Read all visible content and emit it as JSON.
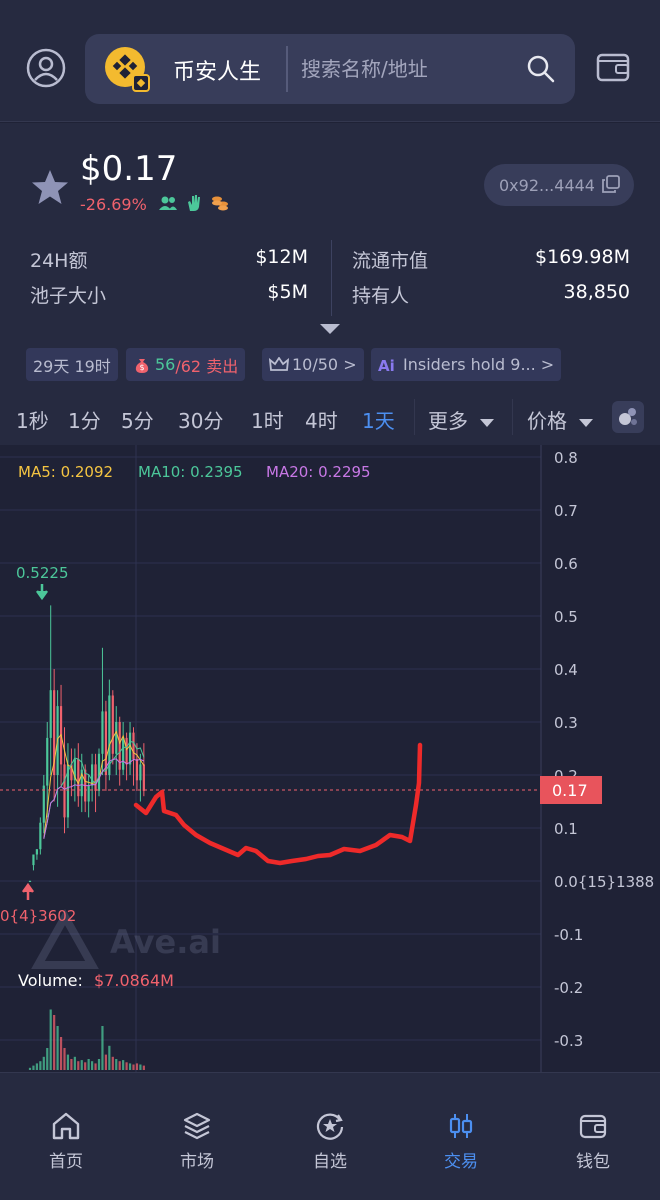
{
  "header": {
    "token_name": "币安人生",
    "search_placeholder": "搜索名称/地址"
  },
  "token": {
    "price": "$0.17",
    "change": "-26.69%",
    "address": "0x92...4444"
  },
  "stats": {
    "volume_label": "24H额",
    "volume": "$12M",
    "pool_label": "池子大小",
    "pool": "$5M",
    "mcap_label": "流通市值",
    "mcap": "$169.98M",
    "holders_label": "持有人",
    "holders": "38,850"
  },
  "tags": {
    "age": "29天 19时",
    "buys": "56",
    "sells_text": "/62 卖出",
    "top": "10/50 >",
    "insiders": "Insiders hold 9... >"
  },
  "timeframes": [
    "1秒",
    "1分",
    "5分",
    "30分",
    "1时",
    "4时",
    "1天"
  ],
  "active_timeframe": "1天",
  "more_label": "更多",
  "price_label": "价格",
  "chart_data": {
    "type": "candlestick",
    "indicators": [
      {
        "name": "MA5",
        "text": "MA5: 0.2092",
        "color": "#f5c542"
      },
      {
        "name": "MA10",
        "text": "MA10: 0.2395",
        "color": "#4cc79a"
      },
      {
        "name": "MA20",
        "text": "MA20: 0.2295",
        "color": "#c878e6"
      }
    ],
    "y_ticks": [
      "0.8",
      "0.7",
      "0.6",
      "0.5",
      "0.4",
      "0.3",
      "0.2",
      "0.1",
      "0.0{15}1388",
      "-0.1",
      "-0.2",
      "-0.3"
    ],
    "current_price": "0.17",
    "high_label": "0.5225",
    "low_label": "0{4}3602",
    "volume_label": "Volume:",
    "volume_value": "$7.0864M",
    "watermark": "Ave.ai",
    "ylim": [
      -0.35,
      0.82
    ]
  },
  "nav": [
    {
      "label": "首页",
      "icon": "home-icon"
    },
    {
      "label": "市场",
      "icon": "layers-icon"
    },
    {
      "label": "自选",
      "icon": "star-circle-icon"
    },
    {
      "label": "交易",
      "icon": "candles-icon"
    },
    {
      "label": "钱包",
      "icon": "wallet-icon"
    }
  ],
  "colors": {
    "up": "#4cc79a",
    "down": "#f0626d",
    "accent": "#4c8ff0",
    "drawing": "#ee2a2a"
  }
}
